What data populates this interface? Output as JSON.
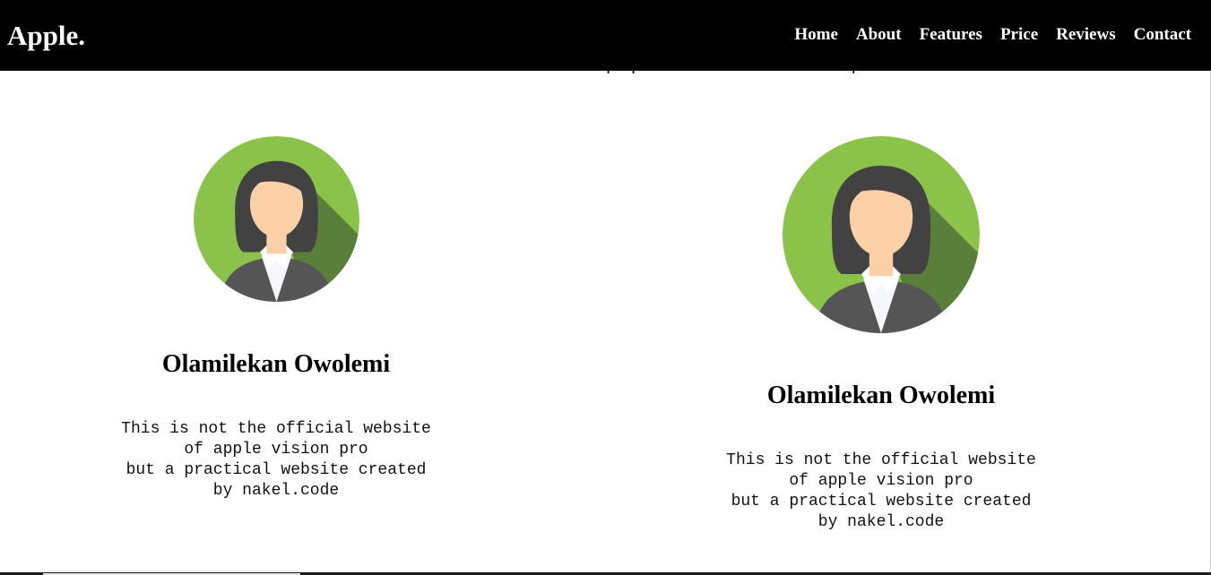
{
  "header": {
    "logo": "Apple.",
    "nav": [
      "Home",
      "About",
      "Features",
      "Price",
      "Reviews",
      "Contact"
    ]
  },
  "cutoff_text": "ullamco laboris nisi ut aliquip ex ea commodo consequat",
  "cards": [
    {
      "name": "Olamilekan Owolemi",
      "description": "This is not the official website\nof apple vision pro\nbut a practical website created\nby nakel.code"
    },
    {
      "name": "Olamilekan Owolemi",
      "description": "This is not the official website\nof apple vision pro\nbut a practical website created\nby nakel.code"
    }
  ],
  "colors": {
    "header_bg": "#000000",
    "header_text": "#ffffff",
    "avatar_green": "#8bc34a",
    "avatar_shadow": "#5a7f3a"
  },
  "icons": {
    "avatar": "female-avatar-icon"
  }
}
